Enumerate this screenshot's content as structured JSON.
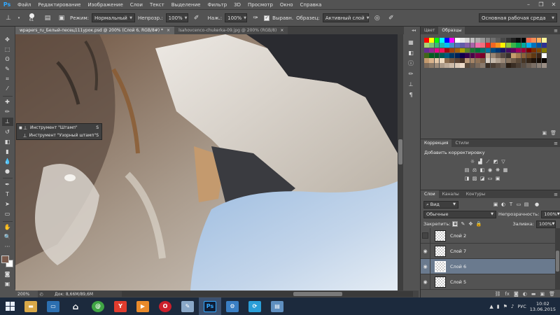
{
  "app": {
    "logo": "Ps",
    "menu": [
      "Файл",
      "Редактирование",
      "Изображение",
      "Слои",
      "Текст",
      "Выделение",
      "Фильтр",
      "3D",
      "Просмотр",
      "Окно",
      "Справка"
    ],
    "window_controls": [
      "minimize-icon",
      "restore-icon",
      "close-icon"
    ]
  },
  "options": {
    "brush_size": "61",
    "mode_label": "Режим:",
    "mode_value": "Нормальный",
    "opacity_label": "Непрозр.:",
    "opacity_value": "100%",
    "pressure_label": "Наж.:",
    "pressure_value": "100%",
    "aligned_label": "Выравн.",
    "sample_label": "Образец:",
    "sample_value": "Активный слой",
    "workspace_value": "Основная рабочая среда"
  },
  "tabs": [
    {
      "label": "wpapers_ru_Белый-песец111урок.psd @ 200% (Слой 6, RGB/8#) *",
      "active": true
    },
    {
      "label": "lsahovcenco-chukerka-09.jpg @ 200% (RGB/8)",
      "active": false
    }
  ],
  "tool_flyout": {
    "items": [
      {
        "label": "Инструмент \"Штамп\"",
        "key": "S",
        "selected": true
      },
      {
        "label": "Инструмент \"Узорный штамп\"",
        "key": "S",
        "selected": false
      }
    ]
  },
  "status": {
    "zoom": "200%",
    "doc_size": "Док: 8,66M/89,6M"
  },
  "swatches_panel": {
    "tabs": [
      "Цвет",
      "Образцы"
    ],
    "active_tab": "Образцы"
  },
  "adjust_panel": {
    "tabs": [
      "Коррекция",
      "Стили"
    ],
    "active_tab": "Коррекция",
    "title": "Добавить корректировку"
  },
  "layers_panel": {
    "tabs": [
      "Слои",
      "Каналы",
      "Контуры"
    ],
    "active_tab": "Слои",
    "filter_label": "Вид",
    "blend_mode": "Обычные",
    "opacity_label": "Непрозрачность:",
    "opacity_value": "100%",
    "lock_label": "Закрепить:",
    "fill_label": "Заливка:",
    "fill_value": "100%",
    "layers": [
      {
        "name": "Слой 2",
        "visible": false,
        "selected": false
      },
      {
        "name": "Слой 7",
        "visible": true,
        "selected": false
      },
      {
        "name": "Слой 6",
        "visible": true,
        "selected": true
      },
      {
        "name": "Слой 5",
        "visible": true,
        "selected": false
      }
    ]
  },
  "taskbar": {
    "language": "РУС",
    "time": "10:02",
    "date": "13.06.2015"
  },
  "colors": {
    "foreground": "#7a5a4c",
    "background": "#ffffff",
    "selected_layer": "#6a7a8e"
  }
}
